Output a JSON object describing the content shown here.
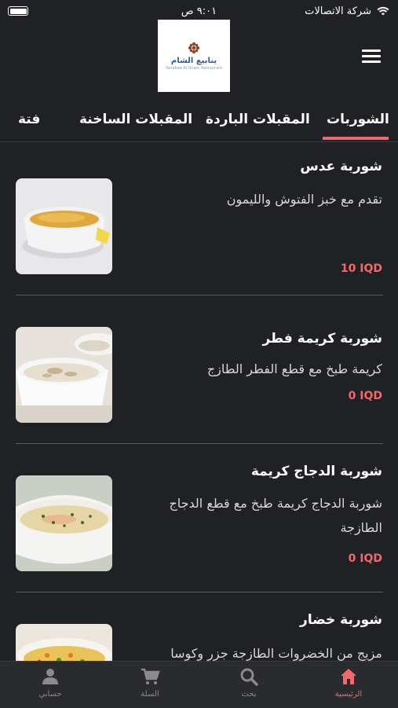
{
  "status_bar": {
    "carrier": "شركة الاتصالات",
    "time": "٩:٠١ ص"
  },
  "logo": {
    "name": "ينابيع الشام",
    "subtitle": "Yanabee Al-Sham Restaurant"
  },
  "tabs": [
    {
      "label": "الشوربات",
      "active": true
    },
    {
      "label": "المقبلات الباردة",
      "active": false
    },
    {
      "label": "المقبلات الساخنة",
      "active": false
    },
    {
      "label": "فتة",
      "active": false
    }
  ],
  "items": [
    {
      "title": "شوربة عدس",
      "description": "تقدم مع خبز الفتوش والليمون",
      "price": "10 IQD",
      "image": "lentil-soup"
    },
    {
      "title": "شوربة كريمة فطر",
      "description": "كريمة طبخ مع قطع الفطر الطازج",
      "price": "0 IQD",
      "image": "mushroom-soup"
    },
    {
      "title": "شوربة الدجاج كريمة",
      "description": "شوربة الدجاج كريمة طبخ مع قطع الدجاج الطازجة",
      "price": "0 IQD",
      "image": "chicken-cream-soup"
    },
    {
      "title": "شوربة خضار",
      "description": "مزيج من الخضروات الطازجة جزر وكوسا",
      "price": "",
      "image": "vegetable-soup"
    }
  ],
  "bottom_nav": [
    {
      "label": "الرئيسية",
      "icon": "home-icon",
      "active": true
    },
    {
      "label": "بحث",
      "icon": "search-icon",
      "active": false
    },
    {
      "label": "السلة",
      "icon": "cart-icon",
      "active": false
    },
    {
      "label": "حسابي",
      "icon": "user-icon",
      "active": false
    }
  ],
  "colors": {
    "background": "#202124",
    "accent": "#f0686e",
    "nav_bg": "#2a2b2e"
  }
}
